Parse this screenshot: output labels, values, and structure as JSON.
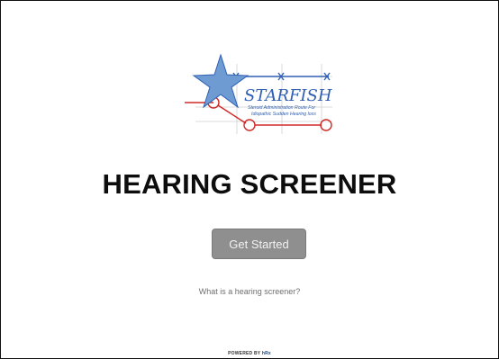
{
  "logo": {
    "wordmark": "STARFISH",
    "tagline_line1": "Steroid Administration Route For",
    "tagline_line2": "Idiopathic Sudden Hearing loss",
    "colors": {
      "blue": "#2f5fb3",
      "red": "#d02828",
      "grid": "#cfcfcf",
      "star": "#6f9bd3"
    }
  },
  "title": "HEARING SCREENER",
  "cta": {
    "label": "Get Started"
  },
  "info_link": {
    "label": "What is a hearing screener?"
  },
  "footer": {
    "powered_by": "POWERED BY",
    "brand": "hRx"
  }
}
